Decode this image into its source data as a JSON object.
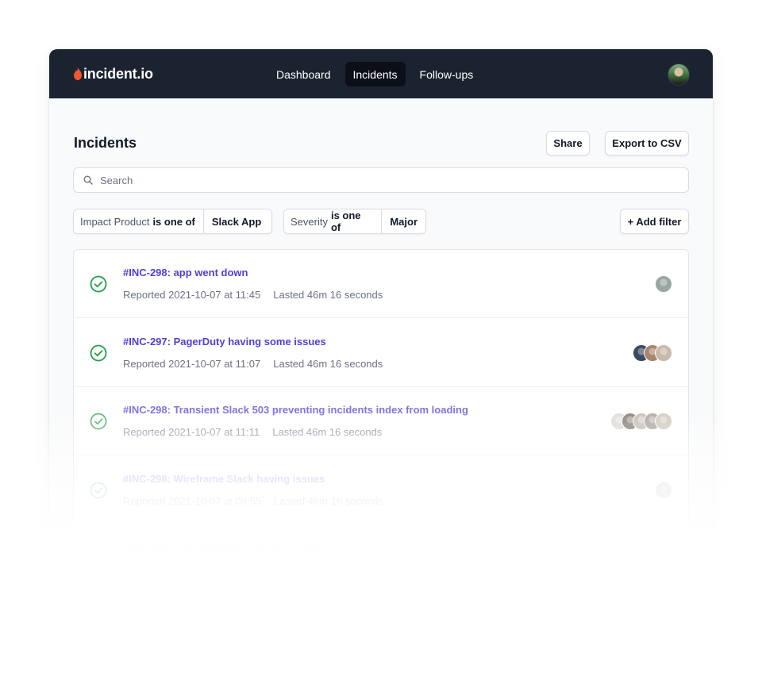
{
  "app": {
    "logo_text": "incident.io",
    "brand_color": "#f25533",
    "nav": [
      {
        "label": "Dashboard",
        "active": false
      },
      {
        "label": "Incidents",
        "active": true
      },
      {
        "label": "Follow-ups",
        "active": false
      }
    ]
  },
  "page": {
    "title": "Incidents",
    "share_label": "Share",
    "export_label": "Export to CSV",
    "search_placeholder": "Search"
  },
  "filters": [
    {
      "field": "Impact Product",
      "operator": "is one of",
      "value": "Slack App"
    },
    {
      "field": "Severity",
      "operator": "is one of",
      "value": "Major"
    }
  ],
  "add_filter_label": "+ Add filter",
  "incidents": [
    {
      "title": "#INC-298: app went down",
      "reported": "Reported 2021-10-07 at 11:45",
      "lasted": "Lasted 46m 16 seconds",
      "status_icon": "check-circle-icon",
      "avatars": [
        "#9aa6a0"
      ]
    },
    {
      "title": "#INC-297: PagerDuty having some issues",
      "reported": "Reported 2021-10-07 at 11:07",
      "lasted": "Lasted 46m 16 seconds",
      "status_icon": "check-circle-icon",
      "avatars": [
        "#3a4a5e",
        "#a8866c",
        "#c9b9a8"
      ]
    },
    {
      "title": "#INC-298: Transient Slack 503 preventing incidents index from loading",
      "reported": "Reported 2021-10-07 at 11:11",
      "lasted": "Lasted 46m 16 seconds",
      "status_icon": "check-circle-icon",
      "avatars": [
        "#d8d2cc",
        "#6b6259",
        "#b8b0a6",
        "#9b9188",
        "#c7bcae"
      ]
    },
    {
      "title": "#INC-298: Wireframe Slack having issues",
      "reported": "Reported 2021-10-07 at 09:55",
      "lasted": "Lasted 46m 16 seconds",
      "status_icon": "check-circle-icon",
      "avatars": [
        "#a6a6a6"
      ]
    },
    {
      "title": "#INC-298: Core functions not processing",
      "reported": "",
      "lasted": "",
      "status_icon": "check-circle-icon",
      "avatars": [
        "#c8c8c8"
      ]
    }
  ],
  "colors": {
    "topbar": "#1b2331",
    "link": "#4f3fd6",
    "success": "#22a046"
  }
}
